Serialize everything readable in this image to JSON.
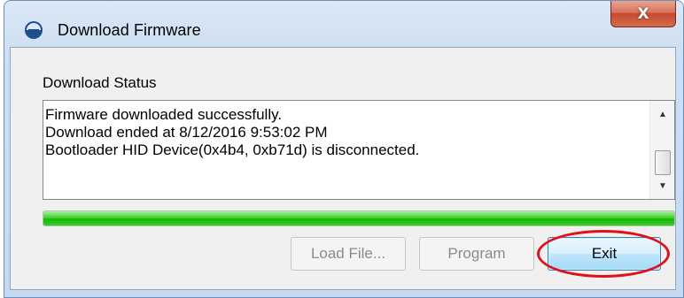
{
  "window": {
    "title": "Download Firmware",
    "close_glyph": "X"
  },
  "status": {
    "label": "Download Status",
    "lines": [
      "Firmware downloaded successfully.",
      "Download ended at 8/12/2016 9:53:02 PM",
      "Bootloader HID Device(0x4b4, 0xb71d) is disconnected."
    ]
  },
  "progress": {
    "percent": 100,
    "color": "#2ecc1c"
  },
  "buttons": {
    "load_file": "Load File...",
    "program": "Program",
    "exit": "Exit"
  },
  "icons": {
    "app": "firmware-app-icon",
    "close": "close-icon",
    "scroll_up": "scroll-up-arrow-icon",
    "scroll_down": "scroll-down-arrow-icon"
  },
  "colors": {
    "highlight": "#e0101e",
    "exit_focus": "#3c7fb1"
  }
}
